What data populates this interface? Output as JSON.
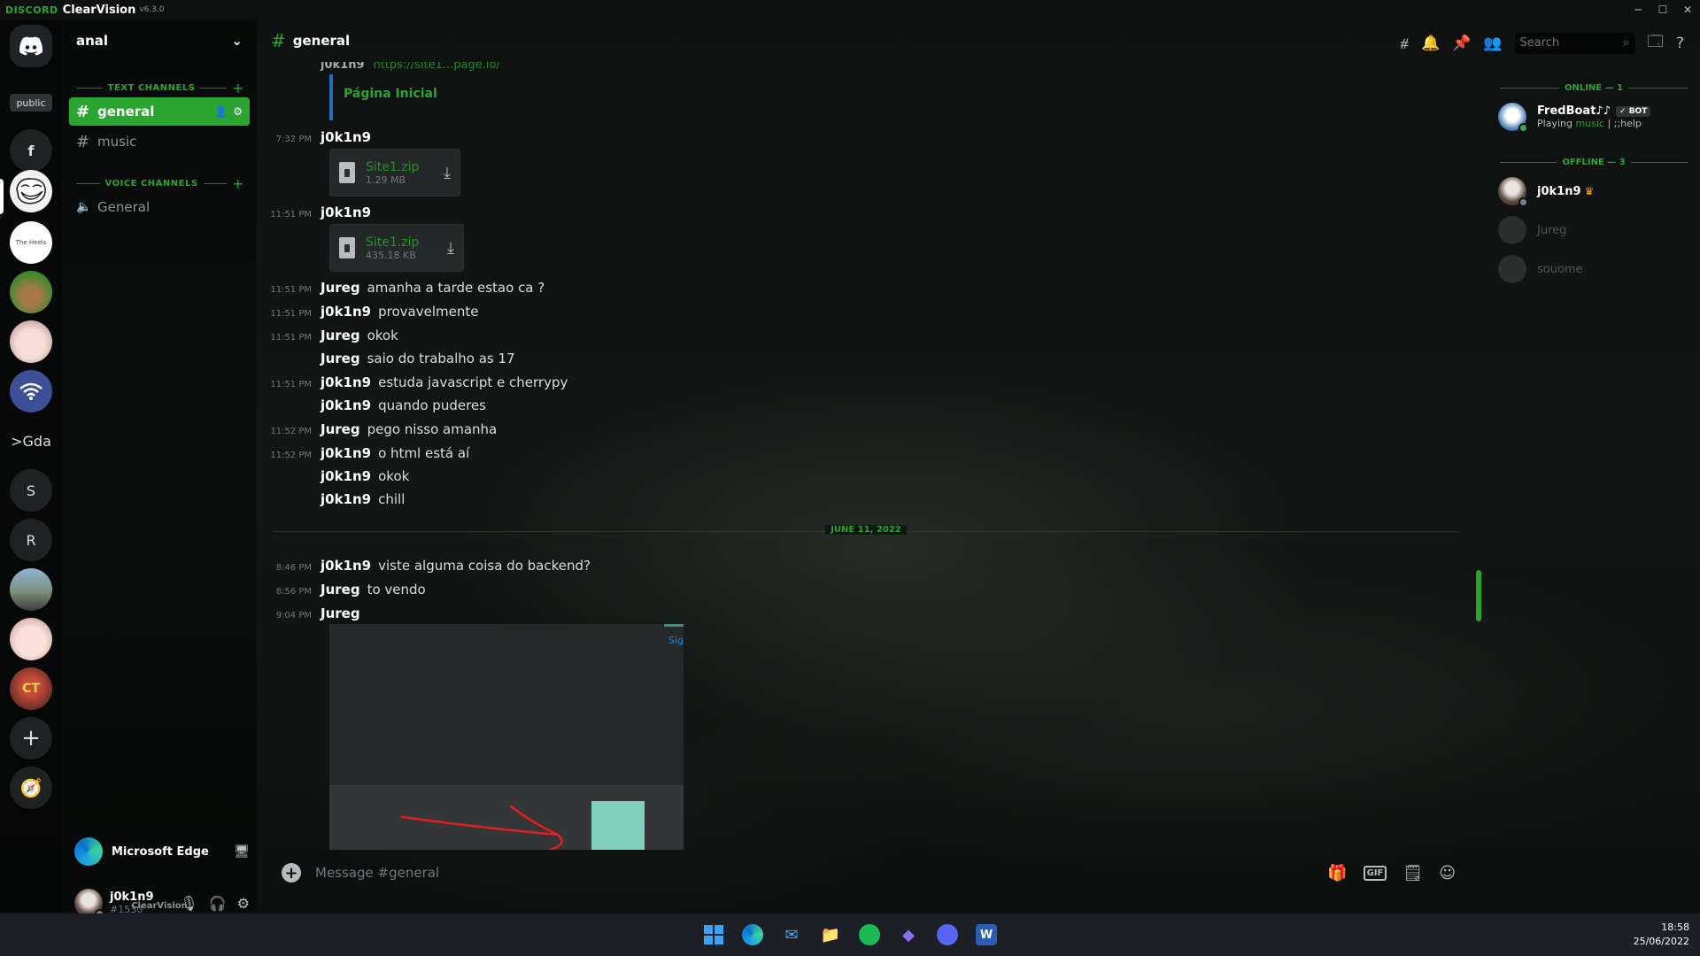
{
  "titlebar": {
    "brand": "DISCORD",
    "product": "ClearVision",
    "version": "v6.3.0"
  },
  "rail": {
    "public_label": "public",
    "servers": [
      {
        "label": "f",
        "name": "server-f"
      },
      {
        "label": "",
        "name": "server-trollface"
      },
      {
        "label": "The Heels",
        "name": "server-the-heels"
      },
      {
        "label": "",
        "name": "server-frog"
      },
      {
        "label": "",
        "name": "server-anime-1"
      },
      {
        "label": "",
        "name": "server-wifi"
      },
      {
        "label": ">Gda",
        "name": "server-gda"
      },
      {
        "label": "S",
        "name": "server-s"
      },
      {
        "label": "R",
        "name": "server-r"
      },
      {
        "label": "",
        "name": "server-road"
      },
      {
        "label": "",
        "name": "server-anime-2"
      },
      {
        "label": "",
        "name": "server-ct"
      }
    ]
  },
  "guild": {
    "name": "anal",
    "text_category": "TEXT CHANNELS",
    "voice_category": "VOICE CHANNELS",
    "channels": [
      "general",
      "music"
    ],
    "voice_channels": [
      "General"
    ]
  },
  "activity": {
    "app": "Microsoft Edge"
  },
  "user": {
    "name": "j0k1n9",
    "discriminator": "#1530",
    "footer": "ClearVision"
  },
  "topbar": {
    "channel": "general",
    "search_placeholder": "Search"
  },
  "messages": {
    "cut_author": "j0k1n9",
    "cut_link": "https://site1...​page.io/",
    "embed_title": "Página Inicial",
    "file_groups": [
      {
        "time": "7:32 PM",
        "author": "j0k1n9",
        "file": "Site1.zip",
        "size": "1.29 MB"
      },
      {
        "time": "11:51 PM",
        "author": "j0k1n9",
        "file": "Site1.zip",
        "size": "435.18 KB"
      }
    ],
    "lines": [
      {
        "time": "11:51 PM",
        "author": "Jureg",
        "text": "amanha a tarde estao ca ?"
      },
      {
        "time": "11:51 PM",
        "author": "j0k1n9",
        "text": "provavelmente"
      },
      {
        "time": "11:51 PM",
        "author": "Jureg",
        "text": "okok"
      },
      {
        "time": "",
        "author": "Jureg",
        "text": "saio do trabalho as 17"
      },
      {
        "time": "11:51 PM",
        "author": "j0k1n9",
        "text": "estuda javascript e cherrypy"
      },
      {
        "time": "",
        "author": "j0k1n9",
        "text": "quando puderes"
      },
      {
        "time": "11:52 PM",
        "author": "Jureg",
        "text": "pego nisso amanha"
      },
      {
        "time": "11:52 PM",
        "author": "j0k1n9",
        "text": "o html está aí"
      },
      {
        "time": "",
        "author": "j0k1n9",
        "text": "okok"
      },
      {
        "time": "",
        "author": "j0k1n9",
        "text": "chill"
      }
    ],
    "date_divider": "JUNE 11, 2022",
    "after_lines": [
      {
        "time": "8:46 PM",
        "author": "j0k1n9",
        "text": "viste alguma coisa do backend?"
      },
      {
        "time": "8:56 PM",
        "author": "Jureg",
        "text": "to vendo"
      },
      {
        "time": "9:04 PM",
        "author": "Jureg",
        "text": ""
      }
    ],
    "image_sig_text": "Sig"
  },
  "composer": {
    "placeholder": "Message #general",
    "gif_label": "GIF"
  },
  "members": {
    "online_header": "ONLINE — 1",
    "offline_header": "OFFLINE — 3",
    "online": [
      {
        "name": "FredBoat♪♪",
        "bot_tag": "✓ BOT",
        "activity_prefix": "Playing ",
        "activity_game": "music",
        "activity_suffix": " | ;;help"
      }
    ],
    "offline": [
      {
        "name": "j0k1n9"
      },
      {
        "name": "Jureg"
      },
      {
        "name": "souome"
      }
    ]
  },
  "taskbar": {
    "time": "18:58",
    "date": "25/06/2022"
  },
  "colors": {
    "accent": "#2aa52f",
    "background": "#0c0f0d",
    "taskbar": "#1c1f26"
  }
}
